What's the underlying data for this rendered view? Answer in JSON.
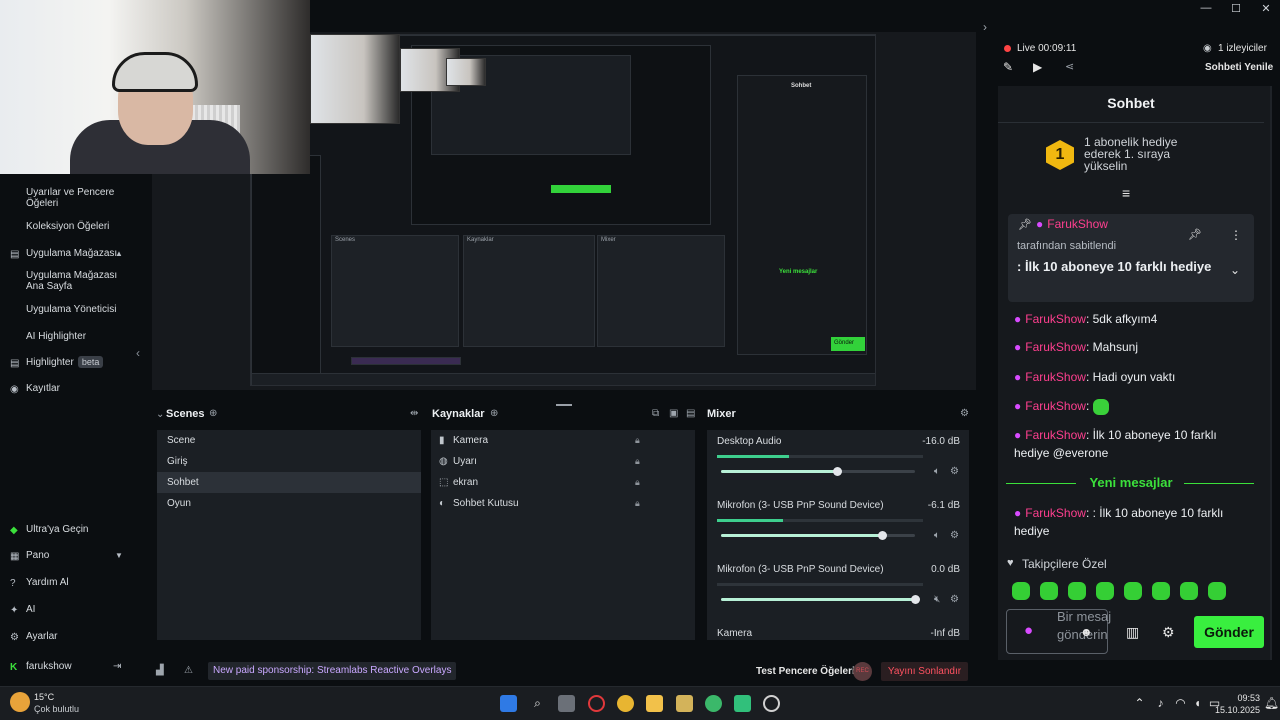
{
  "window": {
    "min_glyph": "—",
    "max_glyph": "☐",
    "close_glyph": "✕"
  },
  "sidebar": {
    "items": [
      {
        "label": "Uyarılar ve Pencere Öğeleri"
      },
      {
        "label": "Koleksiyon Öğeleri"
      },
      {
        "label": "Uygulama Mağazası"
      },
      {
        "label": "Uygulama Mağazası Ana Sayfa"
      },
      {
        "label": "Uygulama Yöneticisi"
      },
      {
        "label": "AI Highlighter"
      },
      {
        "label": "Highlighter",
        "badge": "beta"
      },
      {
        "label": "Kayıtlar"
      },
      {
        "label": "Ultra'ya Geçin"
      },
      {
        "label": "Pano"
      },
      {
        "label": "Yardım Al"
      },
      {
        "label": "AI"
      },
      {
        "label": "Ayarlar"
      },
      {
        "label": "farukshow"
      }
    ]
  },
  "scenes": {
    "title": "Scenes",
    "items": [
      "Scene",
      "Giriş",
      "Sohbet",
      "Oyun"
    ],
    "selected": "Sohbet"
  },
  "sources": {
    "title": "Kaynaklar",
    "items": [
      {
        "name": "Kamera",
        "icon": "camera-icon",
        "glyph": "▮"
      },
      {
        "name": "Uyarı",
        "icon": "globe-icon",
        "glyph": "◍"
      },
      {
        "name": "ekran",
        "icon": "display-capture-icon",
        "glyph": "⬚"
      },
      {
        "name": "Sohbet Kutusu",
        "icon": "chat-icon",
        "glyph": "◐"
      }
    ]
  },
  "mixer": {
    "title": "Mixer",
    "channels": [
      {
        "name": "Desktop Audio",
        "db": "-16.0 dB",
        "level": 0.35,
        "volume": 0.6
      },
      {
        "name": "Mikrofon (3- USB PnP Sound Device)",
        "db": "-6.1 dB",
        "level": 0.32,
        "volume": 0.83
      },
      {
        "name": "Mikrofon (3- USB PnP Sound Device)",
        "db": "0.0 dB",
        "level": 0.0,
        "volume": 1.0
      },
      {
        "name": "Kamera",
        "db": "-Inf dB"
      }
    ]
  },
  "statusbar": {
    "sponsor": "New paid sponsorship: Streamlabs Reactive Overlays",
    "test": "Test Pencere Öğeleri",
    "rec": "REC",
    "end": "Yayını Sonlandır"
  },
  "chat_top": {
    "live": "Live 00:09:11",
    "viewers": "1 izleyiciler",
    "refresh": "Sohbeti Yenile"
  },
  "chat": {
    "title": "Sohbet",
    "goal_rank": "1",
    "goal_text": "1 abonelik hediye ederek 1. sıraya yükselin",
    "pinned_user": "FarukShow",
    "pinned_by": "tarafından sabitlendi",
    "pinned_text": ": İlk 10 aboneye 10 farklı hediye",
    "messages": [
      {
        "user": "FarukShow",
        "text": ": 5dk afkyım4"
      },
      {
        "user": "FarukShow",
        "text": ": Mahsunj"
      },
      {
        "user": "FarukShow",
        "text": ": Hadi oyun vaktı"
      },
      {
        "user": "FarukShow",
        "text": ":"
      },
      {
        "user": "FarukShow",
        "text": ": İlk 10 aboneye 10 farklı hediye @everone"
      }
    ],
    "new_messages": "Yeni mesajlar",
    "latest": {
      "user": "FarukShow",
      "text": ": : İlk 10 aboneye 10 farklı hediye"
    },
    "followers_only": "Takipçilere Özel",
    "input_placeholder": "Bir mesaj gönderin",
    "send": "Gönder"
  },
  "taskbar": {
    "weather_temp": "15°C",
    "weather_desc": "Çok bulutlu",
    "time": "09:53",
    "date": "15.10.2025"
  },
  "preview": {
    "scenes_label": "Scenes",
    "sources_label": "Kaynaklar",
    "mixer_label": "Mixer",
    "chat_label": "Sohbet",
    "send_label": "Gönder",
    "new_label": "Yeni mesajlar"
  },
  "colors": {
    "accent_green": "#39ef3f",
    "username": "#ff3f8f",
    "live": "#ff4444",
    "sponsor": "#c9a8ff"
  }
}
